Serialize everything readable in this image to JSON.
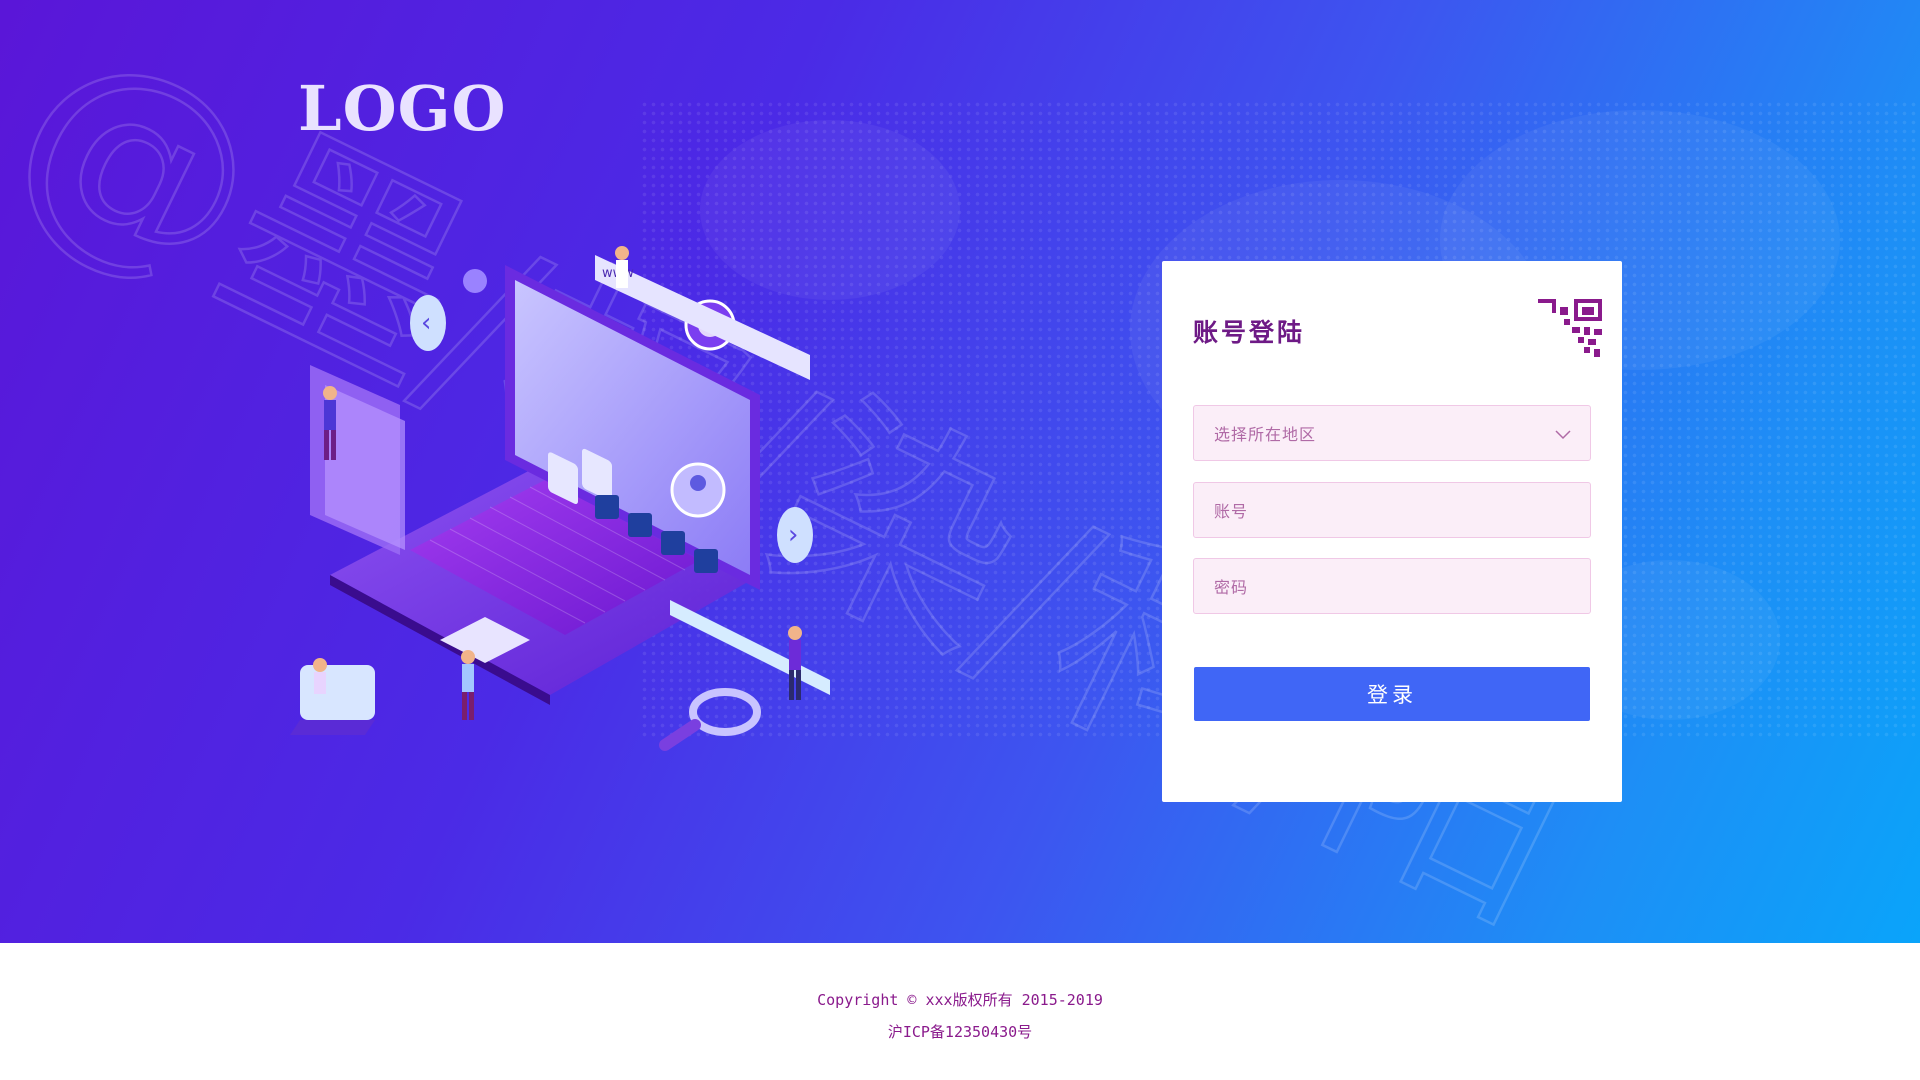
{
  "brand": {
    "logo_text": "LOGO"
  },
  "login_card": {
    "title": "账号登陆",
    "region_select": {
      "placeholder": "选择所在地区",
      "icon": "chevron-down-icon"
    },
    "account_input": {
      "placeholder": "账号"
    },
    "password_input": {
      "placeholder": "密码"
    },
    "submit_label": "登录",
    "qr_icon": "qr-code-icon"
  },
  "watermark": {
    "text": "@墨/权/染/科/阳"
  },
  "footer": {
    "copyright": "Copyright ©  xxx版权所有  2015-2019",
    "icp": "沪ICP备12350430号"
  },
  "colors": {
    "hero_start": "#5a16d8",
    "hero_end": "#0aa4fa",
    "title": "#6e1a86",
    "field_bg": "#fbeef8",
    "button": "#4066f6",
    "footer_text": "#8a1a8c"
  }
}
